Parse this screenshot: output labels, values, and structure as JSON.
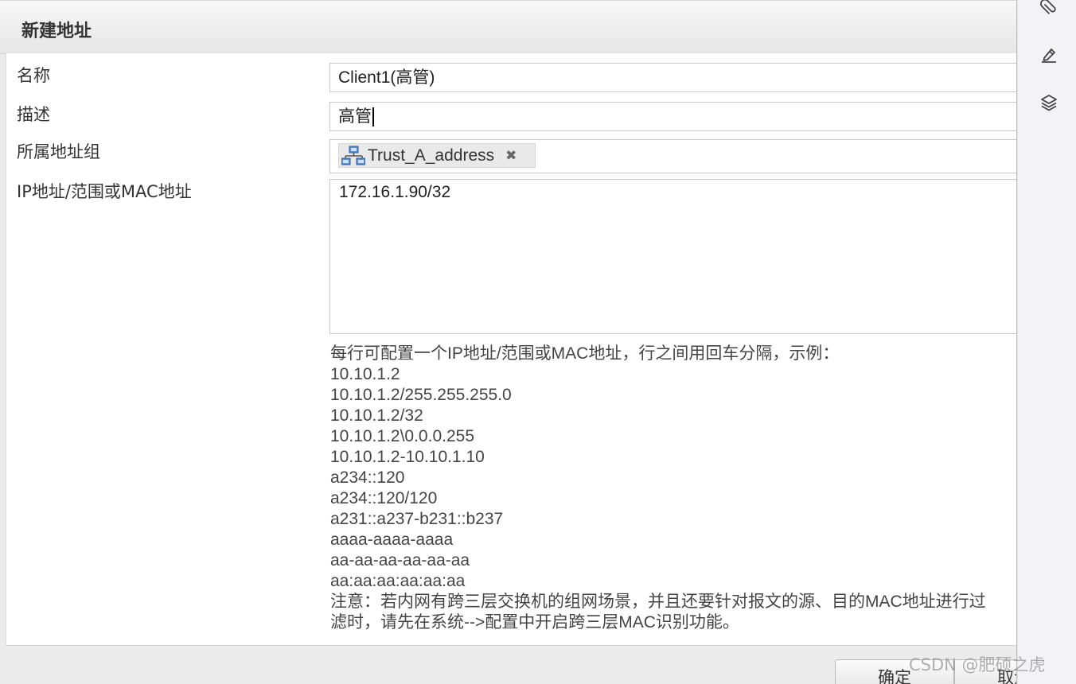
{
  "dialog": {
    "title": "新建地址",
    "fields": {
      "name_label": "名称",
      "name_value": "Client1(高管)",
      "desc_label": "描述",
      "desc_value": "高管",
      "group_label": "所属地址组",
      "group_tag": "Trust_A_address",
      "ip_label": "IP地址/范围或MAC地址",
      "ip_value": "172.16.1.90/32"
    },
    "help": {
      "intro": "每行可配置一个IP地址/范围或MAC地址，行之间用回车分隔，示例：",
      "examples": [
        "10.10.1.2",
        "10.10.1.2/255.255.255.0",
        "10.10.1.2/32",
        "10.10.1.2\\0.0.0.255",
        "10.10.1.2-10.10.1.10",
        "a234::120",
        "a234::120/120",
        "a231::a237-b231::b237",
        "aaaa-aaaa-aaaa",
        "aa-aa-aa-aa-aa-aa",
        "aa:aa:aa:aa:aa:aa"
      ],
      "note_line1": "注意：若内网有跨三层交换机的组网场景，并且还要针对报文的源、目的MAC地址进行过",
      "note_line2": "滤时，请先在系统-->配置中开启跨三层MAC识别功能。"
    },
    "buttons": {
      "ok": "确定",
      "cancel": "取消"
    }
  },
  "side_toolbar": {
    "icons": [
      "paperclip-icon",
      "pen-icon",
      "layers-icon"
    ]
  },
  "watermark": "CSDN @肥硕之虎"
}
